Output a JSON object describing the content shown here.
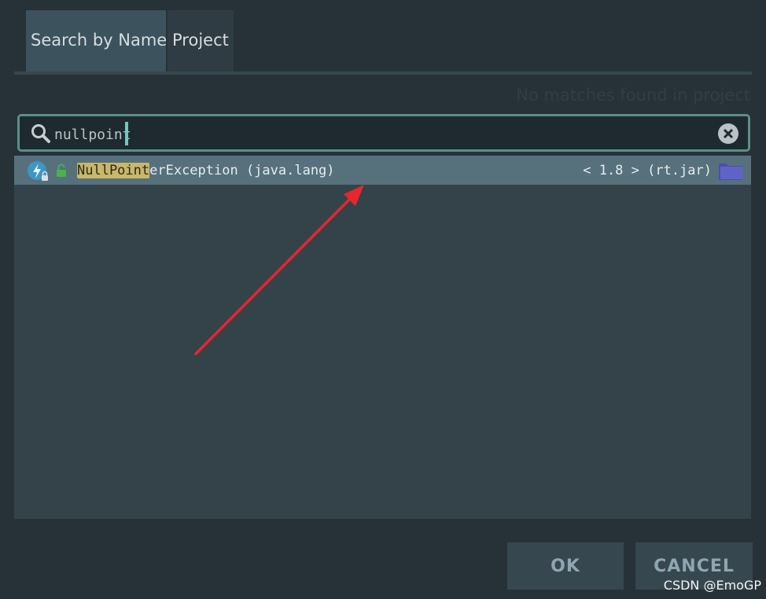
{
  "tabs": [
    {
      "label": "Search by Name",
      "active": true
    },
    {
      "label": "Project",
      "active": false
    }
  ],
  "status_text": "No matches found in project",
  "search": {
    "value": "nullpoint"
  },
  "results": [
    {
      "match": "NullPoint",
      "rest": "erException (java.lang)",
      "meta": "< 1.8 > (rt.jar)",
      "icon": "class-icon",
      "access_icon": "unlocked-icon",
      "location_icon": "folder-icon"
    }
  ],
  "buttons": {
    "ok": "OK",
    "cancel": "CANCEL"
  },
  "watermark": "CSDN @EmoGP",
  "colors": {
    "background": "#263238",
    "input_border": "#5a8f89",
    "selected_row": "#56717c",
    "match_highlight": "#c9b76a",
    "annotation_arrow": "#e8262c",
    "folder": "#5f63c9"
  }
}
